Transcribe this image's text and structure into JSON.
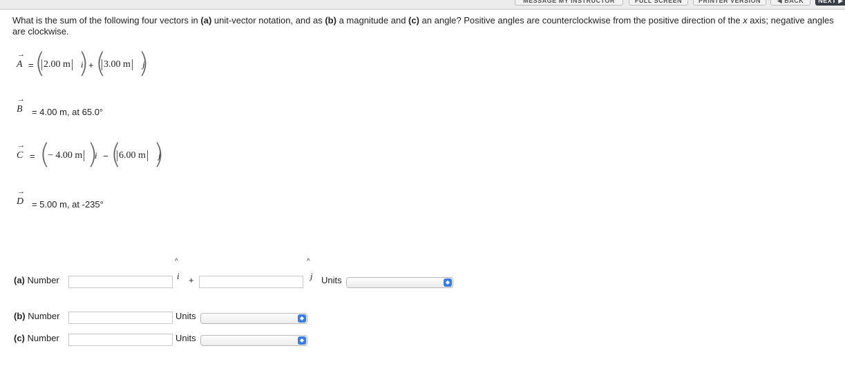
{
  "topbar": {
    "buttons": [
      {
        "label": "MESSAGE MY INSTRUCTOR"
      },
      {
        "label": "FULL SCREEN"
      },
      {
        "label": "PRINTER VERSION"
      },
      {
        "label": "◀ BACK"
      },
      {
        "label": "NEXT ▶"
      }
    ]
  },
  "question": {
    "part1": "What is the sum of the following four vectors in ",
    "a_tag": "(a)",
    "part2": " unit-vector notation, and as ",
    "b_tag": "(b)",
    "part3": " a magnitude and ",
    "c_tag": "(c)",
    "part4": " an angle? Positive angles are counterclockwise from the positive direction of the ",
    "x": "x",
    "part5": " axis; negative angles are clockwise."
  },
  "vectors": {
    "A": {
      "symbol": "A",
      "eq": "=",
      "x": "2.00 m",
      "op": "+",
      "y": "3.00 m",
      "i": "i",
      "j": "j"
    },
    "B": {
      "symbol": "B",
      "text": "= 4.00 m, at 65.0°"
    },
    "C": {
      "symbol": "C",
      "eq": "=",
      "x": "− 4.00 m",
      "op": "−",
      "y": "6.00 m",
      "i": "i",
      "j": "j"
    },
    "D": {
      "symbol": "D",
      "text": "= 5.00 m, at -235°"
    }
  },
  "answers": {
    "a": {
      "tag": "(a)",
      "label": "Number",
      "i": "i",
      "plus": "+",
      "j": "j",
      "units_label": "Units"
    },
    "b": {
      "tag": "(b)",
      "label": "Number",
      "units_label": "Units"
    },
    "c": {
      "tag": "(c)",
      "label": "Number",
      "units_label": "Units"
    }
  }
}
